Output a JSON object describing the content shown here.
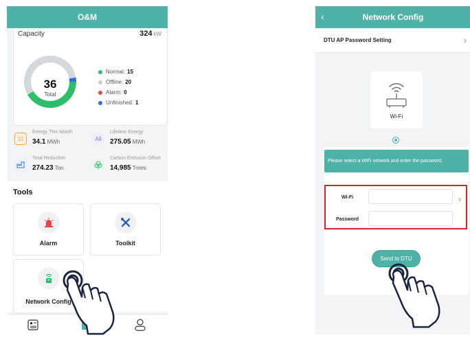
{
  "left_screen": {
    "header_title": "O&M",
    "capacity": {
      "label": "Capacity",
      "value": "324",
      "unit": "kW"
    },
    "donut": {
      "total": "36",
      "total_label": "Total",
      "segments": [
        {
          "name": "Normal",
          "value": 15,
          "color": "#2ebd6b"
        },
        {
          "name": "Offline",
          "value": 20,
          "color": "#d4d7db"
        },
        {
          "name": "Alarm",
          "value": 0,
          "color": "#e84545"
        },
        {
          "name": "Unfinished",
          "value": 1,
          "color": "#2a73d9"
        }
      ]
    },
    "legend": [
      {
        "label": "Normal:",
        "value": "15",
        "color": "#2ebd6b"
      },
      {
        "label": "Offline:",
        "value": "20",
        "color": "#c9ccd0"
      },
      {
        "label": "Alarm:",
        "value": "0",
        "color": "#e84545"
      },
      {
        "label": "Unfinished:",
        "value": "1",
        "color": "#2a73d9"
      }
    ],
    "stats": [
      {
        "title": "Energy This Month",
        "value": "34.1",
        "unit": "MWh",
        "icon": "calendar-icon"
      },
      {
        "title": "Lifetime Energy",
        "value": "275.05",
        "unit": "MWh",
        "icon": "all-energy-icon"
      },
      {
        "title": "Total Reduction",
        "value": "274.23",
        "unit": "Ton",
        "icon": "factory-icon"
      },
      {
        "title": "Carbon Emission Offset",
        "value": "14,985",
        "unit": "Trees",
        "icon": "tree-icon"
      }
    ],
    "tools_title": "Tools",
    "tools": [
      {
        "label": "Alarm",
        "icon": "alarm-siren-icon"
      },
      {
        "label": "Toolkit",
        "icon": "toolkit-icon"
      },
      {
        "label": "Network Config",
        "icon": "router-icon"
      }
    ],
    "tabbar": [
      "dashboard-tab-icon",
      "tools-tab-icon",
      "profile-tab-icon"
    ]
  },
  "right_screen": {
    "header_title": "Network Config",
    "back_glyph": "‹",
    "ap_password_label": "DTU AP Password Setting",
    "ap_chevron": "›",
    "wifi_option_label": "Wi-Fi",
    "banner_text": "Please select a WiFi network and enter the password.",
    "wifi_field": {
      "label": "Wi-Fi",
      "value": ""
    },
    "password_field": {
      "label": "Password",
      "value": ""
    },
    "send_button": "Send to DTU"
  },
  "colors": {
    "accent": "#4fb2a6",
    "highlight": "#d32230"
  }
}
